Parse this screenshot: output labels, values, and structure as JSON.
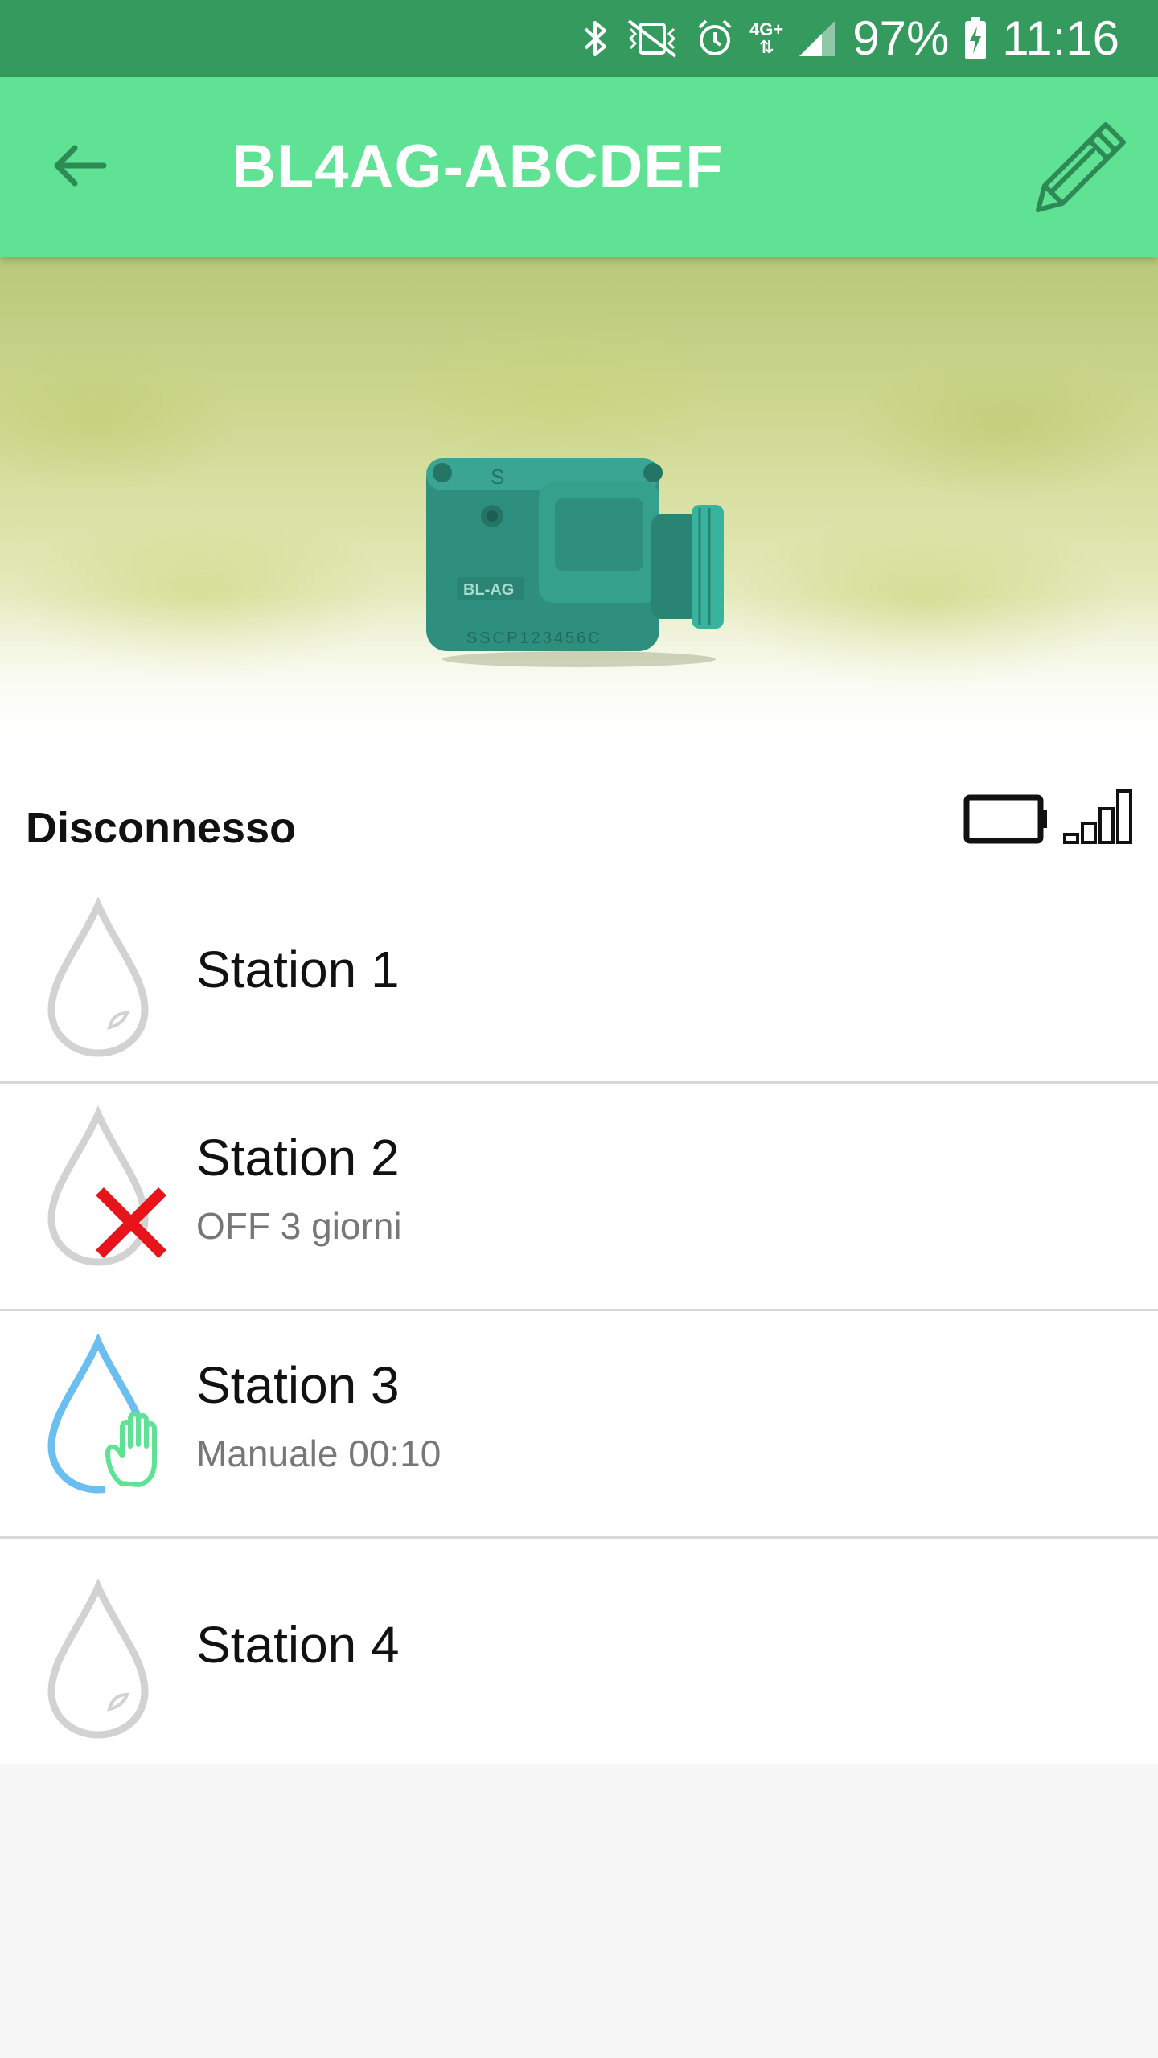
{
  "status_bar": {
    "battery_percent": "97%",
    "time": "11:16",
    "network": "4G+",
    "icons": [
      "bluetooth-icon",
      "vibrate-mute-icon",
      "alarm-icon",
      "data-arrows-icon",
      "cell-signal-icon",
      "battery-charging-icon"
    ]
  },
  "app_bar": {
    "title": "BL4AG-ABCDEF",
    "back_icon": "arrow-left-icon",
    "edit_icon": "pencil-icon"
  },
  "hero": {
    "device_label": "BL-AG",
    "device_serial": "SSCP123456C"
  },
  "connection": {
    "status": "Disconnesso",
    "battery_icon": "battery-empty-icon",
    "signal_icon": "signal-bars-icon"
  },
  "stations": [
    {
      "name": "Station 1",
      "status": "",
      "icon": "water-drop-icon",
      "state": "idle"
    },
    {
      "name": "Station 2",
      "status": "OFF 3 giorni",
      "icon": "water-drop-off-icon",
      "state": "off"
    },
    {
      "name": "Station 3",
      "status": "Manuale 00:10",
      "icon": "water-drop-manual-icon",
      "state": "manual"
    },
    {
      "name": "Station 4",
      "status": "",
      "icon": "water-drop-icon",
      "state": "idle"
    }
  ],
  "colors": {
    "status_bar": "#359a5e",
    "app_bar": "#5fe294",
    "off_red": "#e8141c",
    "manual_green": "#5fe294",
    "active_blue": "#6bbff0",
    "idle_gray": "#d2d2d2"
  }
}
